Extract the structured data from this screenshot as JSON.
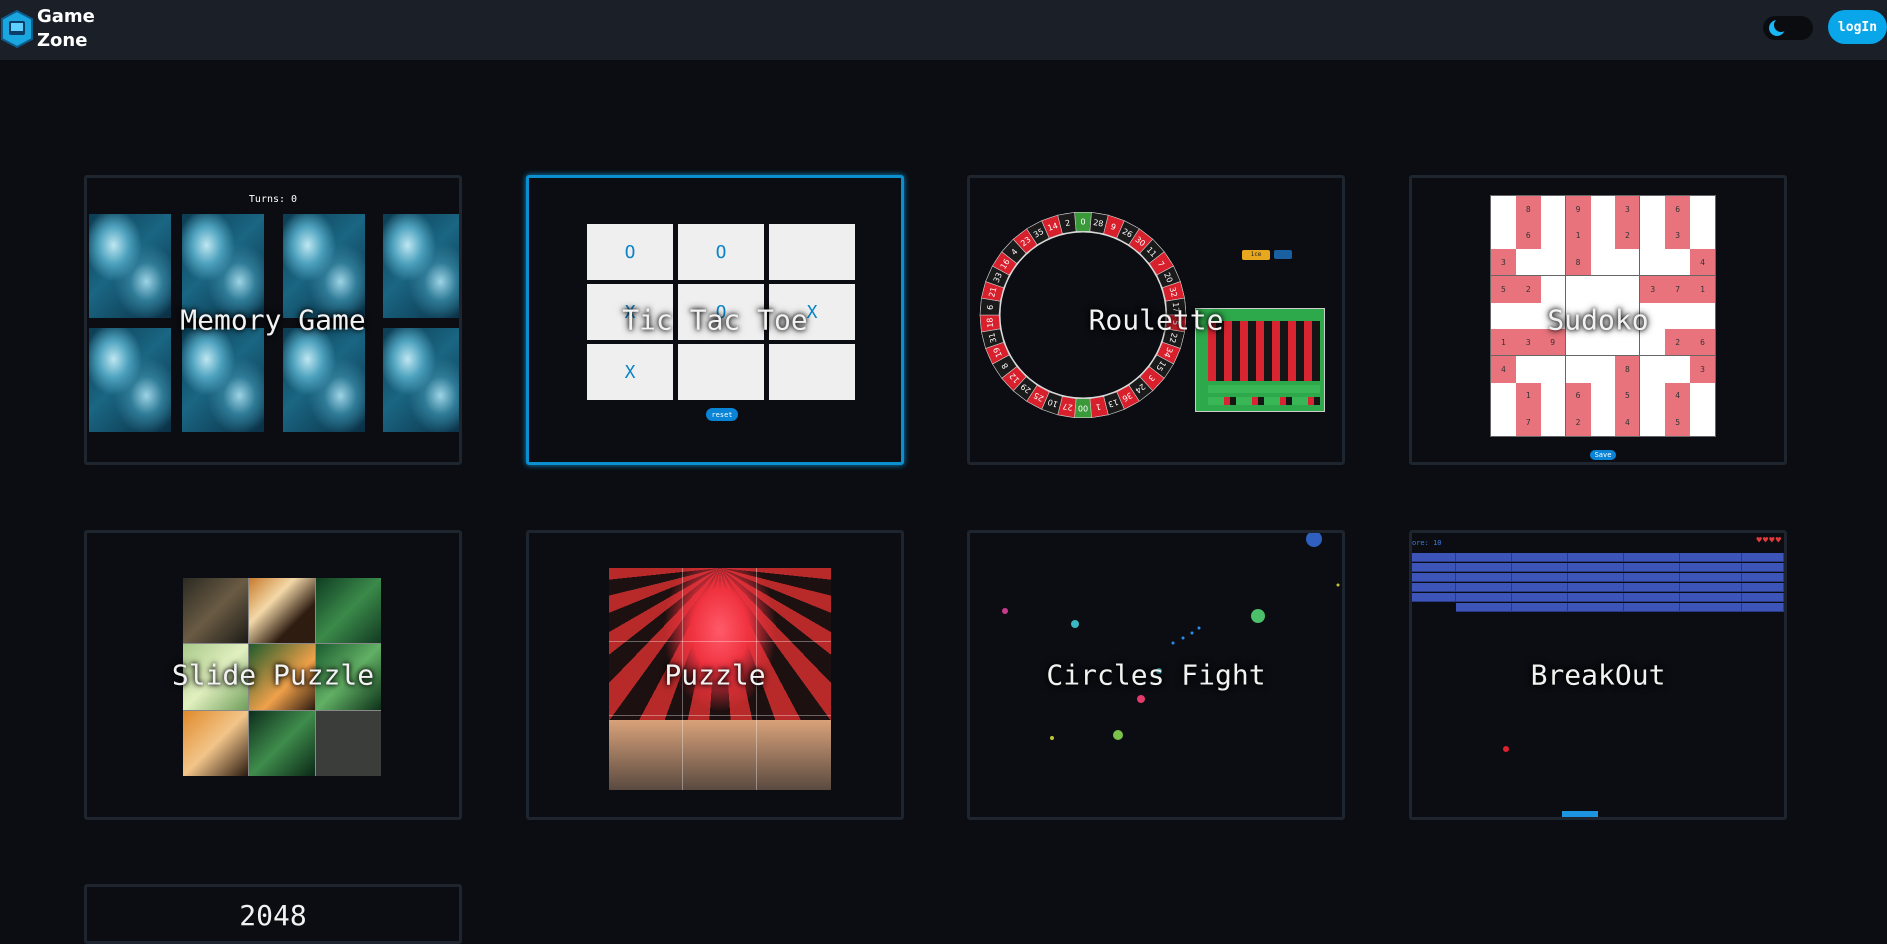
{
  "header": {
    "logo_line1": "Game",
    "logo_line2": "Zone",
    "login_label": "logIn",
    "theme_icon": "moon-icon"
  },
  "colors": {
    "accent": "#0aa6ea",
    "header_bg": "#1b2028",
    "page_bg": "#0b0d12",
    "card_border": "#1e252e",
    "active_border": "#0b8fcf"
  },
  "games": [
    {
      "title": "Memory Game",
      "turns_label": "Turns: 0"
    },
    {
      "title": "Tic Tac Toe",
      "board": [
        "O",
        "O",
        "",
        "X",
        "O",
        "X",
        "X",
        "",
        ""
      ],
      "button": "reset"
    },
    {
      "title": "Roulette",
      "wheel_numbers": [
        "0",
        "28",
        "9",
        "26",
        "30",
        "11",
        "7",
        "20",
        "32",
        "17",
        "5",
        "22",
        "34",
        "15",
        "3",
        "24",
        "36",
        "13",
        "1",
        "00",
        "27",
        "10",
        "25",
        "29",
        "12",
        "8",
        "19",
        "31",
        "18",
        "6",
        "21",
        "33",
        "16",
        "4",
        "23",
        "35",
        "14",
        "2"
      ],
      "bet_label": "1ce"
    },
    {
      "title": "Sudoko",
      "button": "Save"
    },
    {
      "title": "Slide Puzzle"
    },
    {
      "title": "Puzzle"
    },
    {
      "title": "Circles Fight"
    },
    {
      "title": "BreakOut",
      "score_label": "ore: 10",
      "lives": "♥♥♥♥"
    }
  ],
  "partial_card_title": "2048"
}
